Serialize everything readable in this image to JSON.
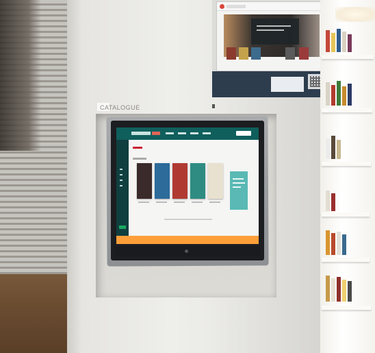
{
  "pillar_sign": {
    "label": "CATALOGUE"
  },
  "colors": {
    "screen_nav": "#0f5f5c",
    "screen_sidebar": "#103f3f",
    "screen_footer": "#ff9f3a",
    "promo_panel": "#5ab9b4"
  },
  "screen": {
    "books": [
      {
        "cover": "#3a2a2a"
      },
      {
        "cover": "#2c6b9a"
      },
      {
        "cover": "#b03a32"
      },
      {
        "cover": "#2f8c82"
      },
      {
        "cover": "#e8e1cf"
      }
    ]
  }
}
